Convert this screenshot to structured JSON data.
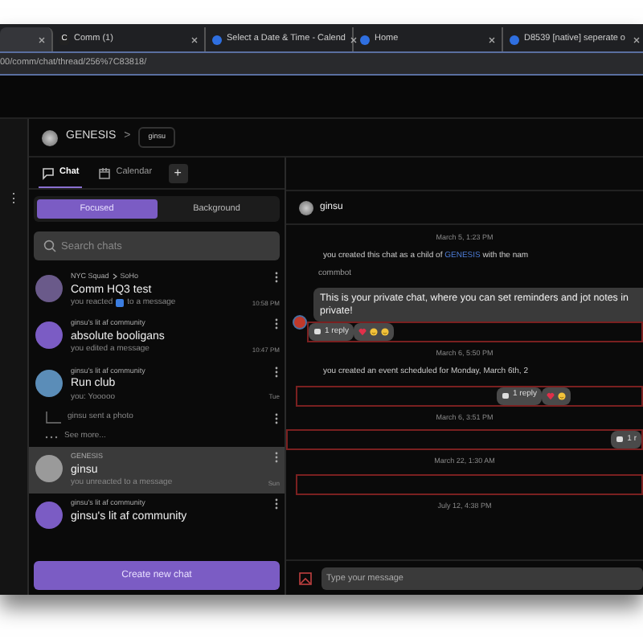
{
  "browser": {
    "tabs": [
      {
        "selected": true
      },
      {
        "title": "Comm (1)",
        "selected": false,
        "icon": "C"
      },
      {
        "title": "Select a Date & Time - Calend",
        "selected": false
      },
      {
        "title": "Home",
        "selected": false
      },
      {
        "title": "D8539 [native] seperate o",
        "selected": false
      }
    ],
    "address": "00/comm/chat/thread/256%7C83818/"
  },
  "rail": {
    "menu": "⋮"
  },
  "breadcrumb": {
    "community": "GENESIS",
    "separator": ">",
    "chat": "ginsu"
  },
  "tabs": [
    {
      "label": "Chat",
      "selected": true
    },
    {
      "label": "Calendar",
      "selected": false
    }
  ],
  "add_tab": "+",
  "segments": [
    {
      "label": "Focused",
      "selected": true
    },
    {
      "label": "Background",
      "selected": false
    }
  ],
  "search": {
    "placeholder": "Search chats"
  },
  "chats": [
    {
      "kind": "chat",
      "parent": "NYC Squad",
      "subparent": "SoHo",
      "name": "Comm HQ3 test",
      "preview": "you reacted",
      "preview_after": "to a message",
      "time": "10:58 PM",
      "color": "#6a5a8a",
      "selected": false
    },
    {
      "kind": "chat",
      "parent": "ginsu's lit af community",
      "name": "absolute booligans",
      "preview": "you edited a message",
      "time": "10:47 PM",
      "color": "#7b5cc4",
      "selected": false
    },
    {
      "kind": "chat",
      "parent": "ginsu's lit af community",
      "name": "Run club",
      "preview": "you: Yooooo",
      "time": "Tue",
      "color": "#5b8db8",
      "selected": false
    },
    {
      "kind": "thread",
      "text": "ginsu sent a photo",
      "selected": false
    },
    {
      "kind": "more",
      "text": "See more..."
    },
    {
      "kind": "chat",
      "parent": "GENESIS",
      "name": "ginsu",
      "preview": "you unreacted to a message",
      "time": "Sun",
      "color": "#9a9a9a",
      "selected": true
    },
    {
      "kind": "chat",
      "parent": "ginsu's lit af community",
      "name": "ginsu's lit af community",
      "color": "#7b5cc4",
      "selected": false
    }
  ],
  "create_button": "Create new chat",
  "thread": {
    "title": "ginsu",
    "messages": [
      {
        "kind": "date",
        "text": "March 5, 1:23 PM"
      },
      {
        "kind": "system",
        "text": "you created this chat as a child of",
        "link": "GENESIS",
        "after": "with the nam"
      },
      {
        "kind": "bot",
        "sender": "commbot",
        "text": "This is your private chat, where you can set reminders and jot notes in private!",
        "replies": "1 reply",
        "reactions": [
          {
            "kind": "heart"
          },
          {
            "kind": "smile"
          },
          {
            "kind": "smile"
          }
        ]
      },
      {
        "kind": "date",
        "text": "March 6, 5:50 PM"
      },
      {
        "kind": "system",
        "text": "you created an event scheduled for Monday, March 6th, 2"
      },
      {
        "kind": "reply_box",
        "replies": "1 reply",
        "reactions": [
          {
            "kind": "heart"
          },
          {
            "kind": "smile"
          }
        ]
      },
      {
        "kind": "date",
        "text": "March 6, 3:51 PM"
      },
      {
        "kind": "edge_box",
        "replies": "1 r"
      },
      {
        "kind": "date",
        "text": "March 22, 1:30 AM"
      },
      {
        "kind": "empty_box"
      },
      {
        "kind": "date",
        "text": "July 12, 4:38 PM"
      }
    ],
    "composer": {
      "placeholder": "Type your message"
    }
  }
}
